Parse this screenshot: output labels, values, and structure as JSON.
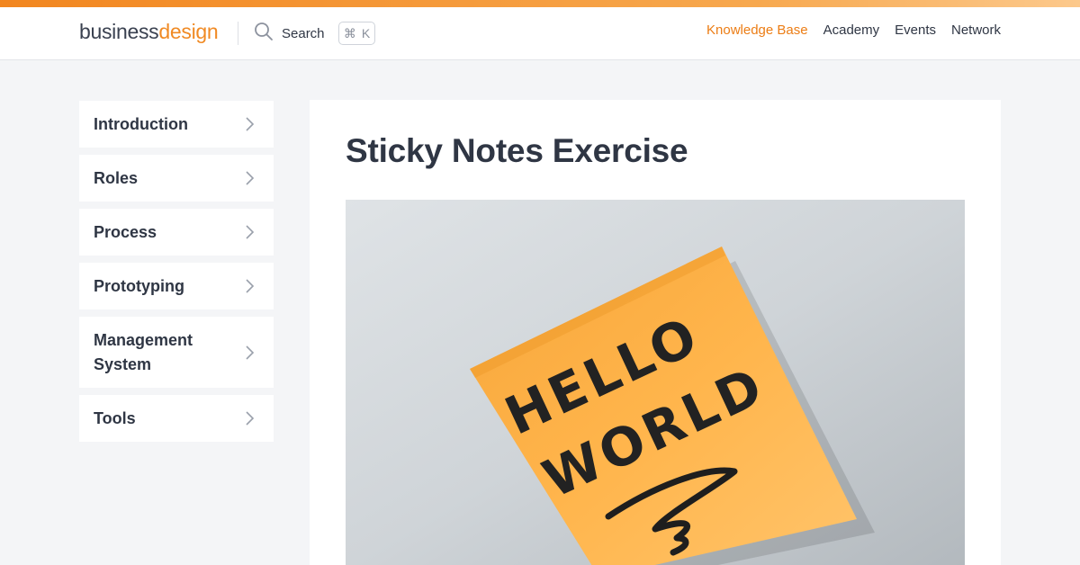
{
  "brand": {
    "word1": "business",
    "word2": "design",
    "accent": "#f08a24"
  },
  "search": {
    "label": "Search",
    "shortcut_symbol": "⌘",
    "shortcut_key": "K"
  },
  "nav": [
    {
      "label": "Knowledge Base",
      "active": true
    },
    {
      "label": "Academy",
      "active": false
    },
    {
      "label": "Events",
      "active": false
    },
    {
      "label": "Network",
      "active": false
    }
  ],
  "sidebar": {
    "items": [
      {
        "label": "Introduction"
      },
      {
        "label": "Roles"
      },
      {
        "label": "Process"
      },
      {
        "label": "Prototyping"
      },
      {
        "label": "Management System"
      },
      {
        "label": "Tools"
      }
    ]
  },
  "article": {
    "title": "Sticky Notes Exercise",
    "image_text_line1": "HELLO",
    "image_text_line2": "WORLD"
  },
  "colors": {
    "accent": "#ec7d15",
    "background": "#f4f5f7",
    "text": "#2f3644",
    "sticky_note": "#ffb24a"
  }
}
